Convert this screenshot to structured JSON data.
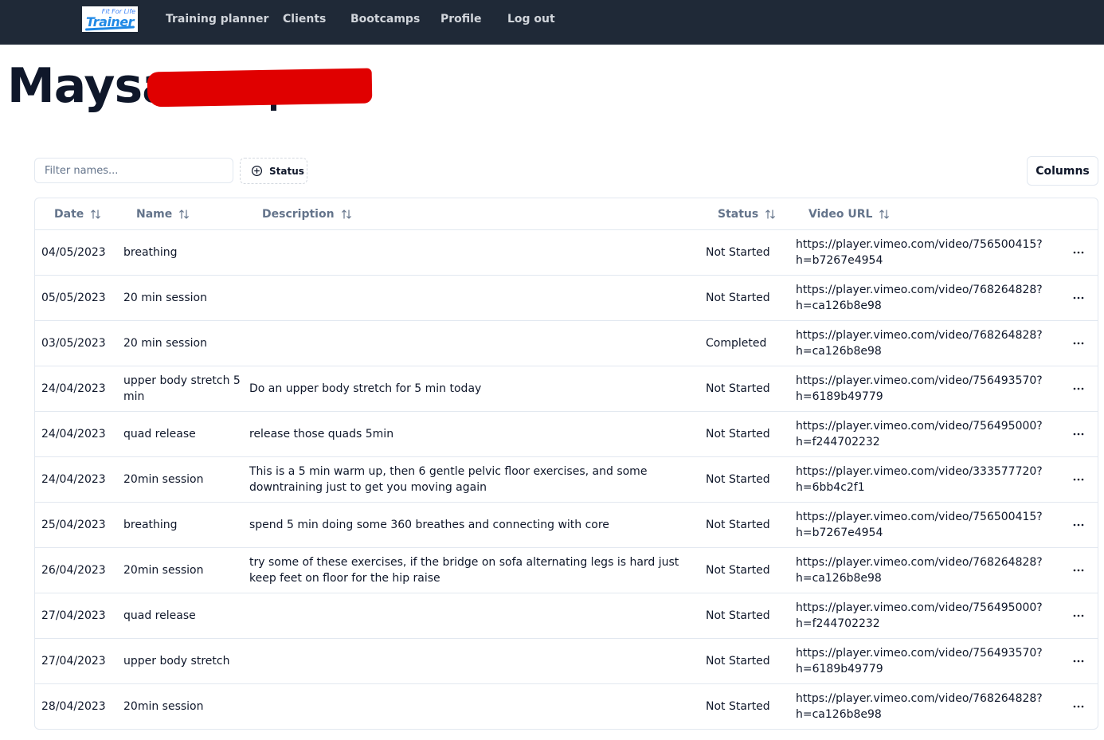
{
  "nav": {
    "logo": {
      "tagline": "Fit For Life",
      "word": "Trainer"
    },
    "links": [
      "Training planner",
      "Clients",
      "Bootcamps",
      "Profile",
      "Log out"
    ]
  },
  "page": {
    "title": "Maysa"
  },
  "toolbar": {
    "filter_placeholder": "Filter names...",
    "status_filter_label": "Status",
    "columns_label": "Columns"
  },
  "table": {
    "headers": [
      "Date",
      "Name",
      "Description",
      "Status",
      "Video URL"
    ],
    "rows": [
      {
        "date": "04/05/2023",
        "name": "breathing",
        "description": "",
        "status": "Not Started",
        "url": "https://player.vimeo.com/video/756500415?h=b7267e4954"
      },
      {
        "date": "05/05/2023",
        "name": "20 min session",
        "description": "",
        "status": "Not Started",
        "url": "https://player.vimeo.com/video/768264828?h=ca126b8e98"
      },
      {
        "date": "03/05/2023",
        "name": "20 min session",
        "description": "",
        "status": "Completed",
        "url": "https://player.vimeo.com/video/768264828?h=ca126b8e98"
      },
      {
        "date": "24/04/2023",
        "name": "upper body stretch 5 min",
        "description": "Do an upper body stretch for 5 min today",
        "status": "Not Started",
        "url": "https://player.vimeo.com/video/756493570?h=6189b49779"
      },
      {
        "date": "24/04/2023",
        "name": "quad release",
        "description": "release those quads 5min",
        "status": "Not Started",
        "url": "https://player.vimeo.com/video/756495000?h=f244702232"
      },
      {
        "date": "24/04/2023",
        "name": "20min session",
        "description": "This is a 5 min warm up, then 6 gentle pelvic floor exercises, and some downtraining just to get you moving again",
        "status": "Not Started",
        "url": "https://player.vimeo.com/video/333577720?h=6bb4c2f1"
      },
      {
        "date": "25/04/2023",
        "name": "breathing",
        "description": "spend 5 min doing some 360 breathes and connecting with core",
        "status": "Not Started",
        "url": "https://player.vimeo.com/video/756500415?h=b7267e4954"
      },
      {
        "date": "26/04/2023",
        "name": "20min session",
        "description": "try some of these exercises, if the bridge on sofa alternating legs is hard just keep feet on floor for the hip raise",
        "status": "Not Started",
        "url": "https://player.vimeo.com/video/768264828?h=ca126b8e98"
      },
      {
        "date": "27/04/2023",
        "name": "quad release",
        "description": "",
        "status": "Not Started",
        "url": "https://player.vimeo.com/video/756495000?h=f244702232"
      },
      {
        "date": "27/04/2023",
        "name": "upper body stretch",
        "description": "",
        "status": "Not Started",
        "url": "https://player.vimeo.com/video/756493570?h=6189b49779"
      },
      {
        "date": "28/04/2023",
        "name": "20min session",
        "description": "",
        "status": "Not Started",
        "url": "https://player.vimeo.com/video/768264828?h=ca126b8e98"
      }
    ]
  },
  "icons": {
    "sort": "sort-arrows-icon",
    "status_filter": "plus-circle-icon",
    "row_actions": "more-horizontal-icon"
  },
  "colors": {
    "navbar": "#1f2937",
    "nav_text": "#d1d5db",
    "header_text": "#64748b",
    "border": "#e2e8f0",
    "redaction": "#e00000",
    "logo_blue": "#1e88e5"
  }
}
